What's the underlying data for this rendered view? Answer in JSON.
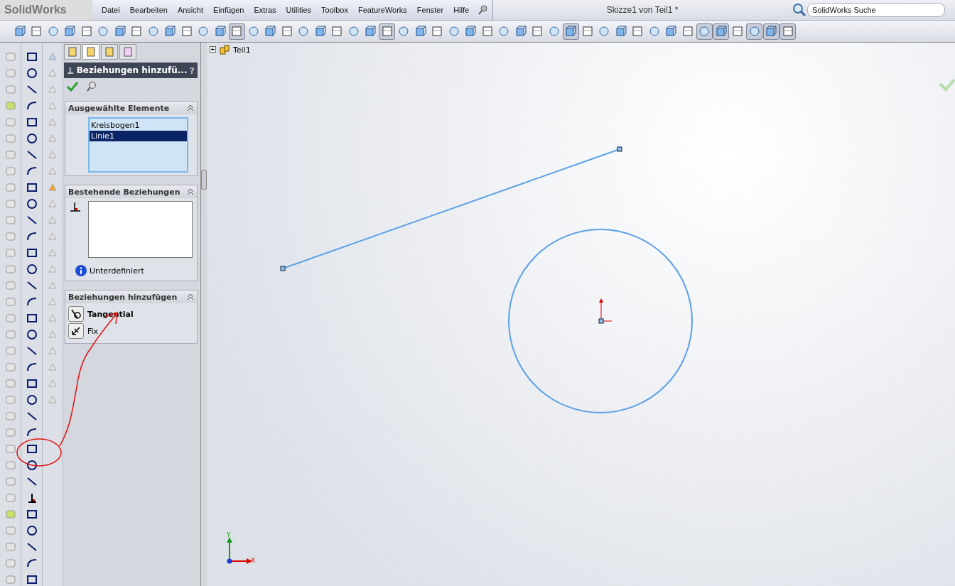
{
  "app": {
    "logo": "SolidWorks"
  },
  "menu": [
    "Datei",
    "Bearbeiten",
    "Ansicht",
    "Einfügen",
    "Extras",
    "Utilities",
    "Toolbox",
    "FeatureWorks",
    "Fenster",
    "Hilfe"
  ],
  "title": "Skizze1 von Teil1 *",
  "search": {
    "placeholder": "SolidWorks Suche"
  },
  "toolbar": [
    {
      "pressed": false
    },
    {
      "pressed": false
    },
    {
      "pressed": false
    },
    {
      "pressed": false
    },
    {
      "pressed": false
    },
    {
      "pressed": false
    },
    {
      "pressed": false
    },
    {
      "pressed": false
    },
    {
      "pressed": false
    },
    {
      "pressed": false
    },
    {
      "pressed": false
    },
    {
      "pressed": false
    },
    {
      "pressed": false
    },
    {
      "pressed": true
    },
    {
      "pressed": false
    },
    {
      "pressed": false
    },
    {
      "pressed": false
    },
    {
      "pressed": false
    },
    {
      "pressed": false
    },
    {
      "pressed": false
    },
    {
      "pressed": false
    },
    {
      "pressed": false
    },
    {
      "pressed": true
    },
    {
      "pressed": false
    },
    {
      "pressed": false
    },
    {
      "pressed": false
    },
    {
      "pressed": false
    },
    {
      "pressed": false
    },
    {
      "pressed": false
    },
    {
      "pressed": false
    },
    {
      "pressed": false
    },
    {
      "pressed": false
    },
    {
      "pressed": false
    },
    {
      "pressed": true
    },
    {
      "pressed": false
    },
    {
      "pressed": false
    },
    {
      "pressed": false
    },
    {
      "pressed": false
    },
    {
      "pressed": false
    },
    {
      "pressed": false
    },
    {
      "pressed": false
    },
    {
      "pressed": true
    },
    {
      "pressed": true
    },
    {
      "pressed": false
    },
    {
      "pressed": true
    },
    {
      "pressed": true
    },
    {
      "pressed": true
    }
  ],
  "panel_tabs": [
    {
      "selected": false
    },
    {
      "selected": true
    },
    {
      "selected": false
    },
    {
      "selected": false
    }
  ],
  "property_manager": {
    "title": "Beziehungen hinzufü...",
    "help": "?"
  },
  "selected_entities": {
    "heading": "Ausgewählte Elemente",
    "items": [
      {
        "label": "Kreisbogen1",
        "selected": false
      },
      {
        "label": "Linie1",
        "selected": true
      }
    ]
  },
  "existing_relations": {
    "heading": "Bestehende Beziehungen",
    "status": "Unterdefiniert"
  },
  "add_relations": {
    "heading": "Beziehungen hinzufügen",
    "items": [
      {
        "label": "Tangential",
        "emphasized": true
      },
      {
        "label": "Fix",
        "emphasized": false
      }
    ]
  },
  "tree": {
    "label": "Teil1"
  },
  "triad": {
    "y": "Y",
    "x": "X"
  }
}
